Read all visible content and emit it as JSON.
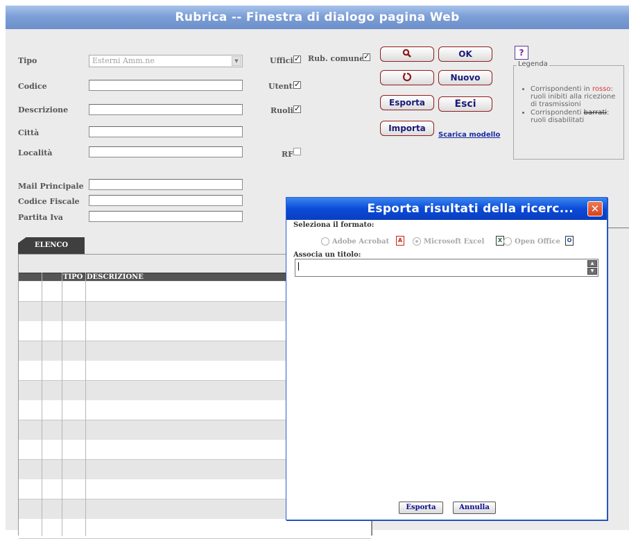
{
  "window": {
    "title": "Rubrica -- Finestra di dialogo pagina Web"
  },
  "form": {
    "tipo": {
      "label": "Tipo",
      "value": "Esterni Amm.ne"
    },
    "codice": {
      "label": "Codice",
      "value": ""
    },
    "descrizione": {
      "label": "Descrizione",
      "value": ""
    },
    "citta": {
      "label": "Città",
      "value": ""
    },
    "localita": {
      "label": "Località",
      "value": ""
    },
    "mail_principale": {
      "label": "Mail Principale",
      "value": ""
    },
    "codice_fiscale": {
      "label": "Codice Fiscale",
      "value": ""
    },
    "partita_iva": {
      "label": "Partita Iva",
      "value": ""
    }
  },
  "filters": {
    "uffici": {
      "label": "Uffici",
      "checked": true
    },
    "rub_comune": {
      "label": "Rub. comune",
      "checked": true
    },
    "utenti": {
      "label": "Utenti",
      "checked": true
    },
    "ruoli": {
      "label": "Ruoli",
      "checked": true
    },
    "rf": {
      "label": "RF",
      "checked": false
    }
  },
  "buttons": {
    "search_icon": "search-icon",
    "reset_icon": "reset-icon",
    "ok": "OK",
    "nuovo": "Nuovo",
    "esporta": "Esporta",
    "esci": "Esci",
    "importa": "Importa",
    "scarica_modello": "Scarica modello",
    "help": "?"
  },
  "legend": {
    "title": "Legenda",
    "item1_prefix": "Corrispondenti in",
    "item1_red": "rosso",
    "item1_suffix": ": ruoli inibiti alla ricezione di trasmissioni",
    "item2_prefix": "Corrispondenti",
    "item2_strike": "barrati",
    "item2_suffix": ": ruoli disabilitati",
    "red_color": "#d63a3a"
  },
  "list": {
    "tab": "ELENCO",
    "columns": [
      "",
      "",
      "TIPO",
      "DESCRIZIONE"
    ],
    "row_count": 13
  },
  "dialog": {
    "title": "Esporta risultati della ricerc...",
    "close": "✕",
    "format_label": "Seleziona il formato:",
    "options": [
      {
        "label": "Adobe Acrobat",
        "icon": "pdf-icon",
        "selected": false
      },
      {
        "label": "Microsoft Excel",
        "icon": "excel-icon",
        "selected": true
      },
      {
        "label": "Open Office",
        "icon": "openoffice-icon",
        "selected": false
      }
    ],
    "title_label": "Associa un titolo:",
    "title_value": "",
    "esporta": "Esporta",
    "annulla": "Annulla"
  },
  "colors": {
    "titlebar": "#7d9fd6",
    "dialog_titlebar": "#0a4bd8",
    "button_border": "#8f1b1b",
    "button_text": "#1a1a7a"
  }
}
